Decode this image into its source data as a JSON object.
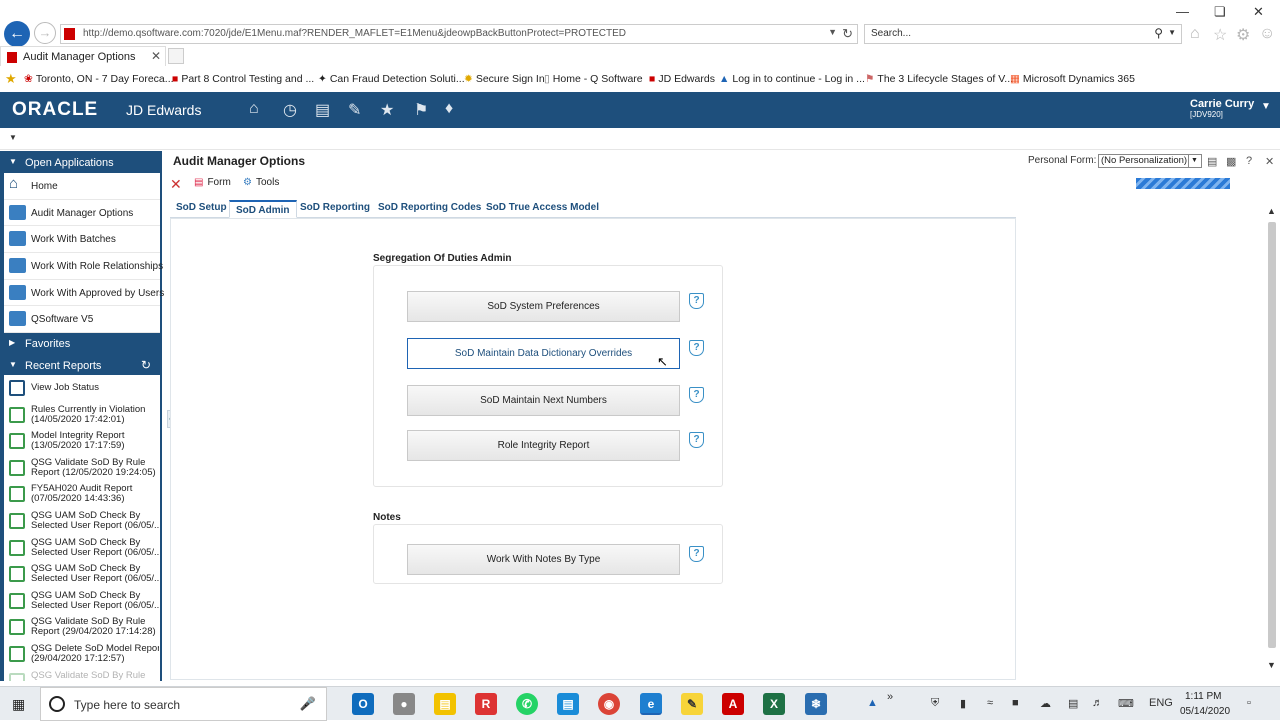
{
  "browser": {
    "url": "http://demo.qsoftware.com:7020/jde/E1Menu.maf?RENDER_MAFLET=E1Menu&jdeowpBackButtonProtect=PROTECTED",
    "search_placeholder": "Search...",
    "tab_title": "Audit Manager Options",
    "favorites": [
      {
        "label": "Toronto, ON - 7 Day Foreca...",
        "icon": "maple-leaf-icon"
      },
      {
        "label": "Part 8  Control Testing and ...",
        "icon": "pdf-icon"
      },
      {
        "label": "Can Fraud Detection Soluti...",
        "icon": "star-icon"
      },
      {
        "label": "Secure Sign In",
        "icon": "sun-icon"
      },
      {
        "label": "Home - Q Software",
        "icon": "page-icon"
      },
      {
        "label": "JD Edwards",
        "icon": "e1-icon"
      },
      {
        "label": "Log in to continue - Log in ...",
        "icon": "atlassian-icon"
      },
      {
        "label": "The 3 Lifecycle Stages of V...",
        "icon": "flag-icon"
      },
      {
        "label": "Microsoft Dynamics 365",
        "icon": "microsoft-icon"
      }
    ]
  },
  "header": {
    "brand": "ORACLE",
    "product": "JD Edwards",
    "user_name": "Carrie Curry",
    "user_env": "[JDV920]"
  },
  "left_pane": {
    "open_apps_title": "Open Applications",
    "open_apps": [
      {
        "label": "Home",
        "icon": "home-icon"
      },
      {
        "label": "Audit Manager Options",
        "icon": "app-icon"
      },
      {
        "label": "Work With Batches",
        "icon": "calculator-icon"
      },
      {
        "label": "Work With Role Relationships",
        "icon": "app-icon"
      },
      {
        "label": "Work With Approved by Users",
        "icon": "calculator-icon"
      },
      {
        "label": "QSoftware V5",
        "icon": "app-icon"
      }
    ],
    "favorites_title": "Favorites",
    "recent_title": "Recent Reports",
    "recent_reports": [
      {
        "line1": "View Job Status",
        "line2": ""
      },
      {
        "line1": "Rules Currently in Violation",
        "line2": "(14/05/2020 17:42:01)"
      },
      {
        "line1": "Model Integrity Report",
        "line2": "(13/05/2020 17:17:59)"
      },
      {
        "line1": "QSG Validate SoD By Rule",
        "line2": "Report (12/05/2020 19:24:05)"
      },
      {
        "line1": "FY5AH020 Audit Report",
        "line2": "(07/05/2020 14:43:36)"
      },
      {
        "line1": "QSG UAM SoD Check By",
        "line2": "Selected User Report (06/05/..."
      },
      {
        "line1": "QSG UAM SoD Check By",
        "line2": "Selected User Report (06/05/..."
      },
      {
        "line1": "QSG UAM SoD Check By",
        "line2": "Selected User Report (06/05/..."
      },
      {
        "line1": "QSG UAM SoD Check By",
        "line2": "Selected User Report (06/05/..."
      },
      {
        "line1": "QSG Validate SoD By Rule",
        "line2": "Report (29/04/2020 17:14:28)"
      },
      {
        "line1": "QSG Delete SoD Model Report",
        "line2": "(29/04/2020 17:12:57)"
      },
      {
        "line1": "QSG Validate SoD By Rule",
        "line2": ""
      }
    ]
  },
  "form": {
    "title": "Audit Manager Options",
    "personal_form_label": "Personal Form:",
    "personal_form_value": "(No Personalization)",
    "toolbar": {
      "form": "Form",
      "tools": "Tools"
    },
    "tabs": [
      "SoD Setup",
      "SoD Admin",
      "SoD Reporting",
      "SoD Reporting Codes",
      "SoD True Access Model"
    ],
    "active_tab": "SoD Admin",
    "section1_title": "Segregation Of Duties Admin",
    "section1_buttons": [
      "SoD System Preferences",
      "SoD Maintain Data Dictionary Overrides",
      "SoD Maintain Next Numbers",
      "Role Integrity Report"
    ],
    "section2_title": "Notes",
    "section2_buttons": [
      "Work With Notes By Type"
    ]
  },
  "taskbar": {
    "search_placeholder": "Type here to search",
    "language": "ENG",
    "time": "1:11 PM",
    "date": "05/14/2020"
  }
}
